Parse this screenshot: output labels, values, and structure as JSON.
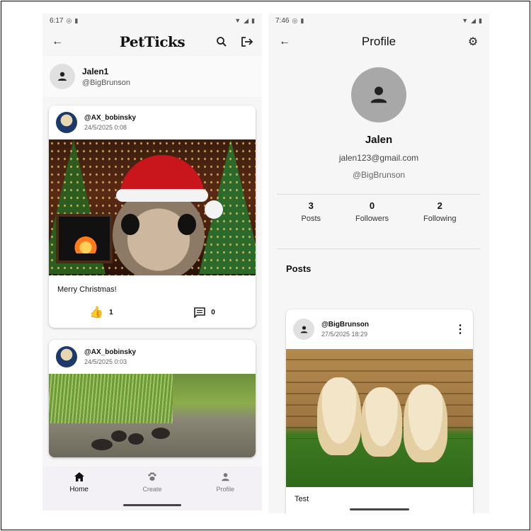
{
  "left_screen": {
    "status": {
      "time": "6:17"
    },
    "app_title": "PetTicks",
    "user": {
      "name": "Jalen1",
      "handle": "@BigBrunson"
    },
    "posts": [
      {
        "username": "@AX_bobinsky",
        "date": "24/5/2025 0:08",
        "caption": "Merry Christmas!",
        "likes": "1",
        "comments": "0"
      },
      {
        "username": "@AX_bobinsky",
        "date": "24/5/2025 0:03"
      }
    ],
    "nav": {
      "home": "Home",
      "create": "Create",
      "profile": "Profile"
    }
  },
  "right_screen": {
    "status": {
      "time": "7:46"
    },
    "title": "Profile",
    "profile": {
      "name": "Jalen",
      "email": "jalen123@gmail.com",
      "handle": "@BigBrunson"
    },
    "stats": [
      {
        "value": "3",
        "label": "Posts"
      },
      {
        "value": "0",
        "label": "Followers"
      },
      {
        "value": "2",
        "label": "Following"
      }
    ],
    "posts_heading": "Posts",
    "post": {
      "username": "@BigBrunson",
      "date": "27/5/2025 18:29",
      "caption": "Test"
    }
  },
  "colors": {
    "like": "#3f8fe0",
    "avatar_large": "#a8a8a8",
    "background": "#f6f6f6"
  }
}
